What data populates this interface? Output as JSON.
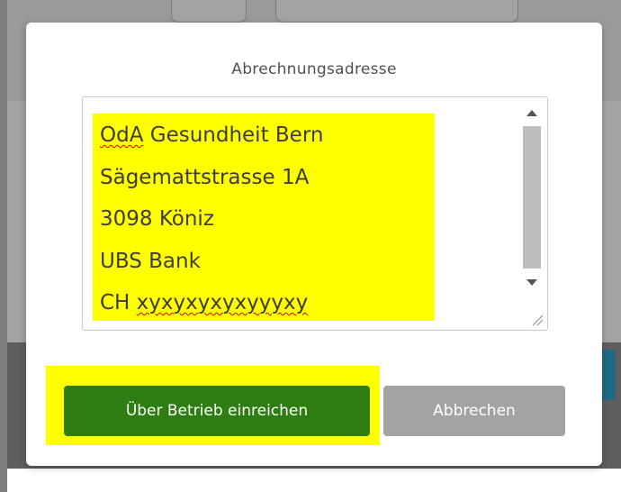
{
  "dialog": {
    "title": "Abrechnungsadresse"
  },
  "address": {
    "lines": [
      "OdA Gesundheit Bern",
      "Sägemattstrasse 1A",
      "3098 Köniz",
      "UBS Bank",
      "CH xyxyxyxyxyyyxy"
    ],
    "line1_prefix": "OdA",
    "line1_rest": " Gesundheit Bern",
    "line5_prefix": "CH ",
    "line5_rest": "xyxyxyxyxyyyxy"
  },
  "buttons": {
    "submit_label": "Über Betrieb einreichen",
    "cancel_label": "Abbrechen"
  },
  "colors": {
    "highlight": "#ffff00",
    "submit": "#2e7d12",
    "cancel": "#a3a3a3",
    "spellcheck": "#d00000"
  },
  "icons": [
    "scroll-up-icon",
    "scroll-down-icon",
    "resize-handle-icon"
  ]
}
